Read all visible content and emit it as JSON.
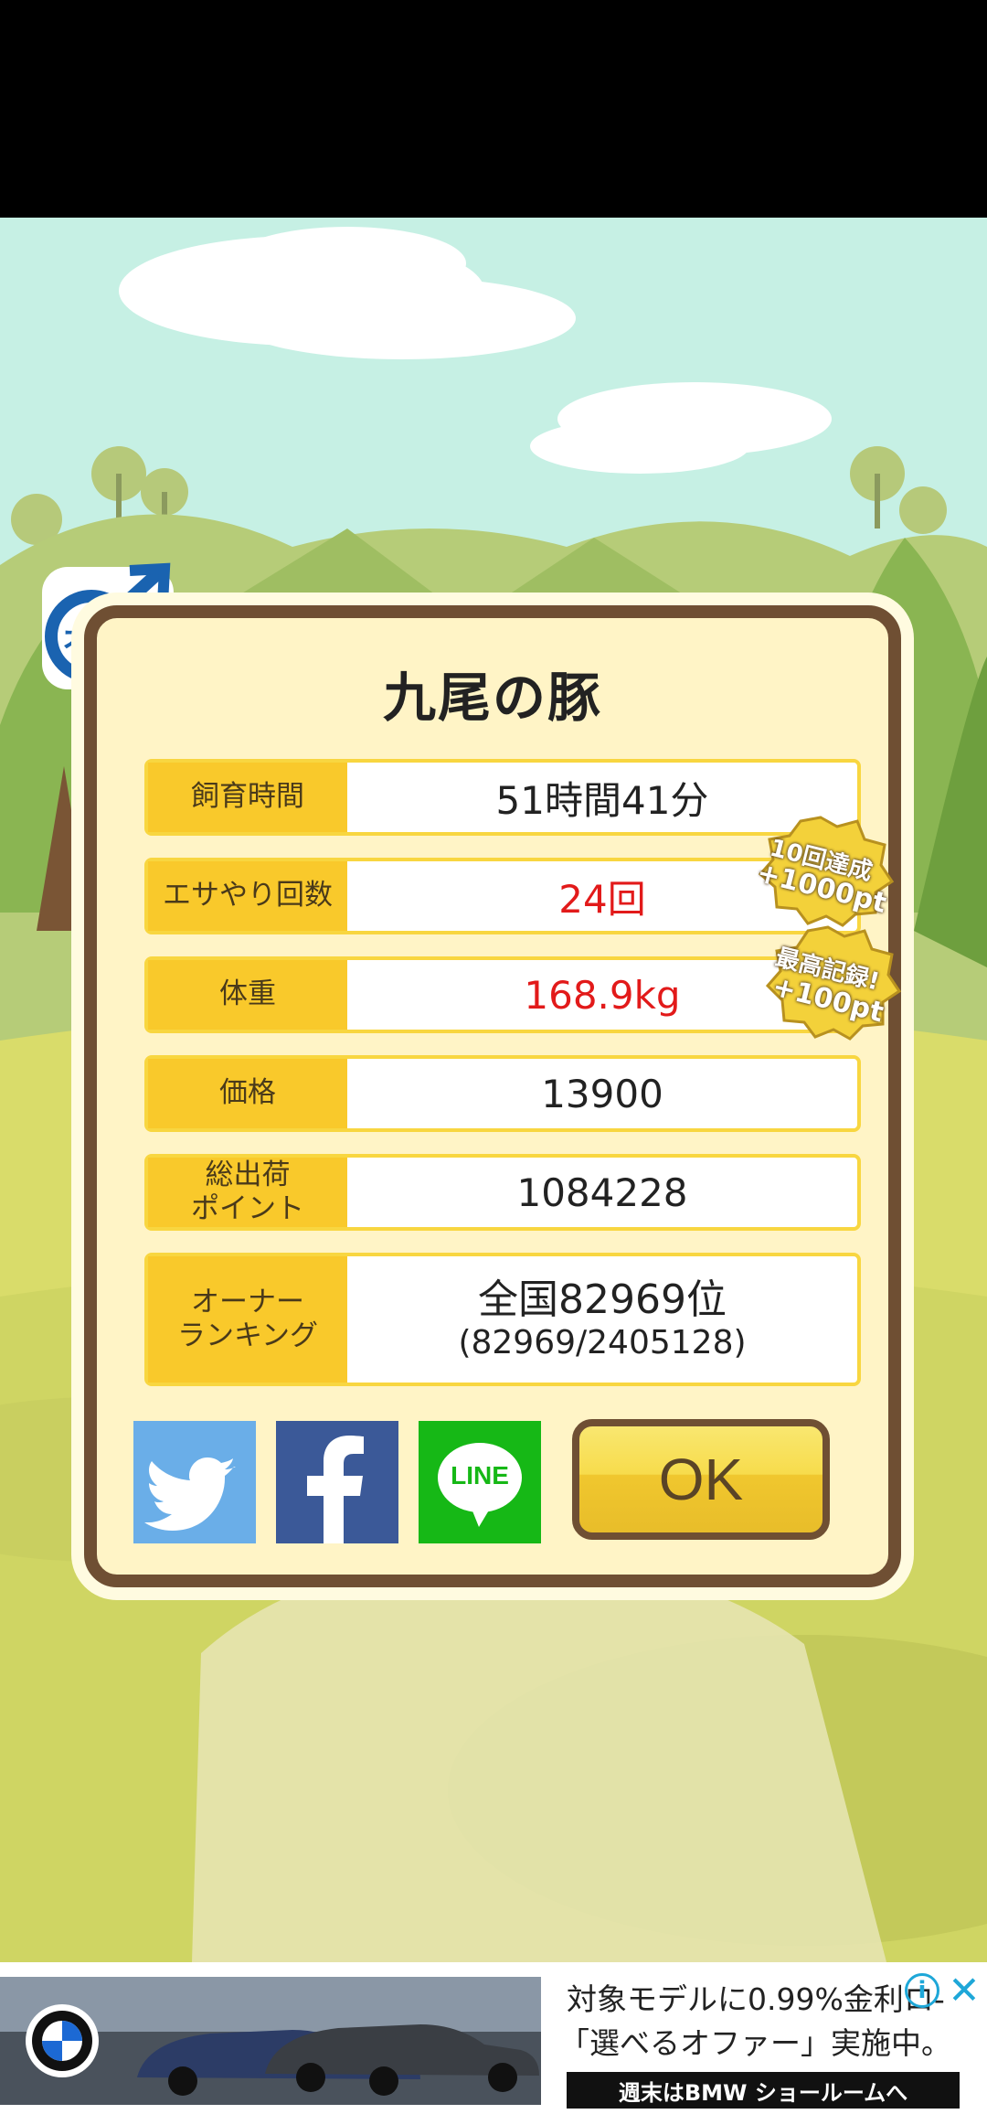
{
  "pig_name": "九尾の豚",
  "gender_badge": "オス",
  "stats": [
    {
      "label": "飼育時間",
      "value": "51時間41分"
    },
    {
      "label": "エサやり回数",
      "value": "24回"
    },
    {
      "label": "体重",
      "value": "168.9kg"
    },
    {
      "label": "価格",
      "value": "13900"
    },
    {
      "label": "総出荷\nポイント",
      "value": "1084228"
    }
  ],
  "ranking": {
    "label": "オーナー\nランキング",
    "value_line1": "全国82969位",
    "value_line2": "(82969/2405128)"
  },
  "medals": [
    {
      "line1": "10回達成",
      "line2": "+1000pt"
    },
    {
      "line1": "最高記録!",
      "line2": "+100pt"
    }
  ],
  "share_buttons": [
    {
      "name": "twitter",
      "color": "#6aaee8"
    },
    {
      "name": "facebook",
      "color": "#3b5998"
    },
    {
      "name": "line",
      "color": "#16b816",
      "text": "LINE"
    }
  ],
  "ok_label": "OK",
  "ad": {
    "text1": "対象モデルに0.99%金利ロ-",
    "text2": "「選べるオファー」実施中。",
    "banner": "週末はBMW ショールームへ",
    "info_icon": "i",
    "close_icon": "✕"
  },
  "colors": {
    "label_bg": "#f9c92b",
    "dialog_bg": "#fff4c6",
    "dialog_border": "#6f4f33",
    "highlight_red": "#e21a1a"
  }
}
